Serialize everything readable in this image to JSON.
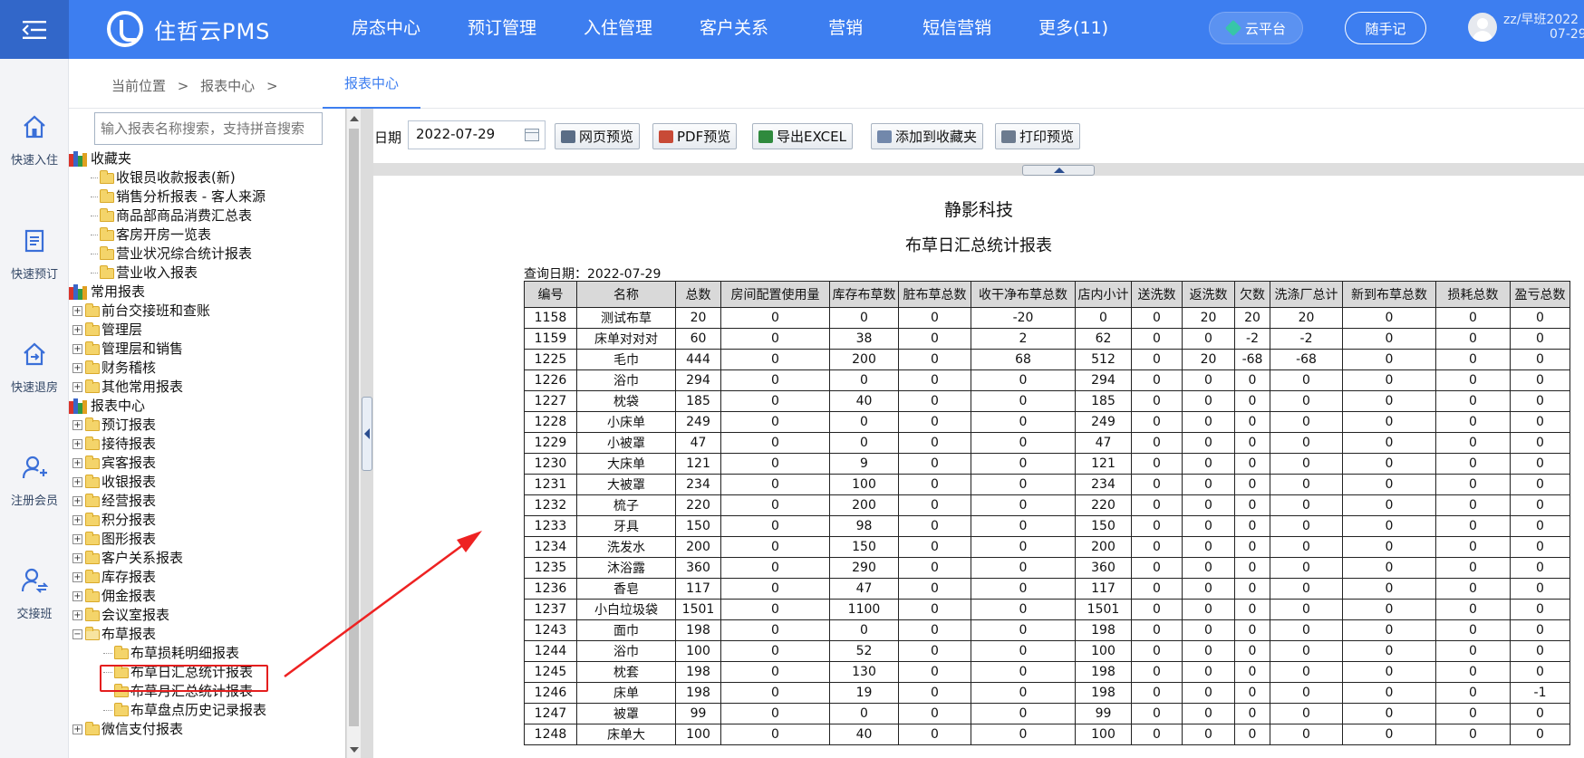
{
  "topbar": {
    "brand": "住哲云PMS",
    "nav": [
      "房态中心",
      "预订管理",
      "入住管理",
      "客户关系",
      "营销",
      "短信营销",
      "更多(11)"
    ],
    "cloud_label": "云平台",
    "note_label": "随手记",
    "user_line1": "zz/早班2022",
    "user_line2": "07-29"
  },
  "quickbar": [
    {
      "label": "快速入住",
      "icon": "home-icon"
    },
    {
      "label": "快速预订",
      "icon": "document-icon"
    },
    {
      "label": "快速退房",
      "icon": "checkout-icon"
    },
    {
      "label": "注册会员",
      "icon": "add-user-icon"
    },
    {
      "label": "交接班",
      "icon": "switch-user-icon"
    }
  ],
  "breadcrumb": {
    "items": [
      "当前位置",
      ">",
      "报表中心",
      ">"
    ],
    "active_tab": "报表中心"
  },
  "tree": {
    "search_placeholder": "输入报表名称搜索，支持拼音搜索",
    "favorites_label": "收藏夹",
    "favorites": [
      "收银员收款报表(新)",
      "销售分析报表 - 客人来源",
      "商品部商品消费汇总表",
      "客房开房一览表",
      "营业状况综合统计报表",
      "营业收入报表"
    ],
    "common_label": "常用报表",
    "common": [
      "前台交接班和查账",
      "管理层",
      "管理层和销售",
      "财务稽核",
      "其他常用报表"
    ],
    "center_label": "报表中心",
    "center": [
      "预订报表",
      "接待报表",
      "宾客报表",
      "收银报表",
      "经营报表",
      "积分报表",
      "图形报表",
      "客户关系报表",
      "库存报表",
      "佣金报表",
      "会议室报表"
    ],
    "linen_label": "布草报表",
    "linen": [
      "布草损耗明细报表",
      "布草日汇总统计报表",
      "布草月汇总统计报表",
      "布草盘点历史记录报表"
    ],
    "after": [
      "微信支付报表"
    ]
  },
  "toolbar": {
    "date_label": "日期",
    "date_value": "2022-07-29",
    "buttons": [
      "网页预览",
      "PDF预览",
      "导出EXCEL",
      "添加到收藏夹",
      "打印预览"
    ]
  },
  "report": {
    "company": "静影科技",
    "title": "布草日汇总统计报表",
    "query_date": "查询日期：2022-07-29",
    "columns": [
      "编号",
      "名称",
      "总数",
      "房间配置使用量",
      "库存布草数",
      "脏布草总数",
      "收干净布草总数",
      "店内小计",
      "送洗数",
      "返洗数",
      "欠数",
      "洗涤厂总计",
      "新到布草总数",
      "损耗总数",
      "盈亏总数"
    ],
    "rows": [
      [
        "1158",
        "测试布草",
        "20",
        "0",
        "0",
        "0",
        "-20",
        "0",
        "0",
        "20",
        "20",
        "20",
        "0",
        "0",
        "0"
      ],
      [
        "1159",
        "床单对对对",
        "60",
        "0",
        "38",
        "0",
        "2",
        "62",
        "0",
        "0",
        "-2",
        "-2",
        "0",
        "0",
        "0"
      ],
      [
        "1225",
        "毛巾",
        "444",
        "0",
        "200",
        "0",
        "68",
        "512",
        "0",
        "20",
        "-68",
        "-68",
        "0",
        "0",
        "0"
      ],
      [
        "1226",
        "浴巾",
        "294",
        "0",
        "0",
        "0",
        "0",
        "294",
        "0",
        "0",
        "0",
        "0",
        "0",
        "0",
        "0"
      ],
      [
        "1227",
        "枕袋",
        "185",
        "0",
        "40",
        "0",
        "0",
        "185",
        "0",
        "0",
        "0",
        "0",
        "0",
        "0",
        "0"
      ],
      [
        "1228",
        "小床单",
        "249",
        "0",
        "0",
        "0",
        "0",
        "249",
        "0",
        "0",
        "0",
        "0",
        "0",
        "0",
        "0"
      ],
      [
        "1229",
        "小被罩",
        "47",
        "0",
        "0",
        "0",
        "0",
        "47",
        "0",
        "0",
        "0",
        "0",
        "0",
        "0",
        "0"
      ],
      [
        "1230",
        "大床单",
        "121",
        "0",
        "9",
        "0",
        "0",
        "121",
        "0",
        "0",
        "0",
        "0",
        "0",
        "0",
        "0"
      ],
      [
        "1231",
        "大被罩",
        "234",
        "0",
        "100",
        "0",
        "0",
        "234",
        "0",
        "0",
        "0",
        "0",
        "0",
        "0",
        "0"
      ],
      [
        "1232",
        "梳子",
        "220",
        "0",
        "200",
        "0",
        "0",
        "220",
        "0",
        "0",
        "0",
        "0",
        "0",
        "0",
        "0"
      ],
      [
        "1233",
        "牙具",
        "150",
        "0",
        "98",
        "0",
        "0",
        "150",
        "0",
        "0",
        "0",
        "0",
        "0",
        "0",
        "0"
      ],
      [
        "1234",
        "洗发水",
        "200",
        "0",
        "150",
        "0",
        "0",
        "200",
        "0",
        "0",
        "0",
        "0",
        "0",
        "0",
        "0"
      ],
      [
        "1235",
        "沐浴露",
        "360",
        "0",
        "290",
        "0",
        "0",
        "360",
        "0",
        "0",
        "0",
        "0",
        "0",
        "0",
        "0"
      ],
      [
        "1236",
        "香皂",
        "117",
        "0",
        "47",
        "0",
        "0",
        "117",
        "0",
        "0",
        "0",
        "0",
        "0",
        "0",
        "0"
      ],
      [
        "1237",
        "小白垃圾袋",
        "1501",
        "0",
        "1100",
        "0",
        "0",
        "1501",
        "0",
        "0",
        "0",
        "0",
        "0",
        "0",
        "0"
      ],
      [
        "1243",
        "面巾",
        "198",
        "0",
        "0",
        "0",
        "0",
        "198",
        "0",
        "0",
        "0",
        "0",
        "0",
        "0",
        "0"
      ],
      [
        "1244",
        "浴巾",
        "100",
        "0",
        "52",
        "0",
        "0",
        "100",
        "0",
        "0",
        "0",
        "0",
        "0",
        "0",
        "0"
      ],
      [
        "1245",
        "枕套",
        "198",
        "0",
        "130",
        "0",
        "0",
        "198",
        "0",
        "0",
        "0",
        "0",
        "0",
        "0",
        "0"
      ],
      [
        "1246",
        "床单",
        "198",
        "0",
        "19",
        "0",
        "0",
        "198",
        "0",
        "0",
        "0",
        "0",
        "0",
        "0",
        "-1"
      ],
      [
        "1247",
        "被罩",
        "99",
        "0",
        "0",
        "0",
        "0",
        "99",
        "0",
        "0",
        "0",
        "0",
        "0",
        "0",
        "0"
      ],
      [
        "1248",
        "床单大",
        "100",
        "0",
        "40",
        "0",
        "0",
        "100",
        "0",
        "0",
        "0",
        "0",
        "0",
        "0",
        "0"
      ]
    ]
  },
  "colors": {
    "topbar": "#3d7ef0",
    "accent": "#3d7ef0",
    "highlight": "#e41e1e"
  }
}
